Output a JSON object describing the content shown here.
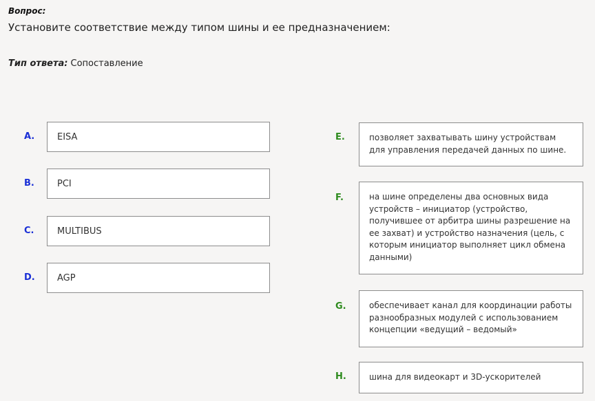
{
  "question": {
    "label": "Вопрос:",
    "text": "Установите соответствие между типом шины и ее предназначением:"
  },
  "answer_type": {
    "label": "Тип ответа:",
    "value": "Сопоставление"
  },
  "left_items": [
    {
      "letter": "A.",
      "text": "EISA"
    },
    {
      "letter": "B.",
      "text": "PCI"
    },
    {
      "letter": "C.",
      "text": "MULTIBUS"
    },
    {
      "letter": "D.",
      "text": "AGP"
    }
  ],
  "right_items": [
    {
      "letter": "E.",
      "text": "позволяет захватывать шину устройствам для управления передачей данных по шине."
    },
    {
      "letter": "F.",
      "text": "на шине определены два основных вида устройств – инициатор (устройство, получившее от арбитра шины разрешение на ее захват) и устройство назначения (цель, с которым инициатор выполняет цикл обмена данными)"
    },
    {
      "letter": "G.",
      "text": "обеспечивает канал для координации работы разнообразных модулей с использованием концепции «ведущий – ведомый»"
    },
    {
      "letter": "H.",
      "text": "шина для видеокарт и 3D-ускорителей"
    }
  ],
  "colors": {
    "left_letter": "#1a2fd6",
    "right_letter": "#2e8b1e",
    "box_border": "#8c8c8c",
    "background": "#f6f5f4"
  }
}
